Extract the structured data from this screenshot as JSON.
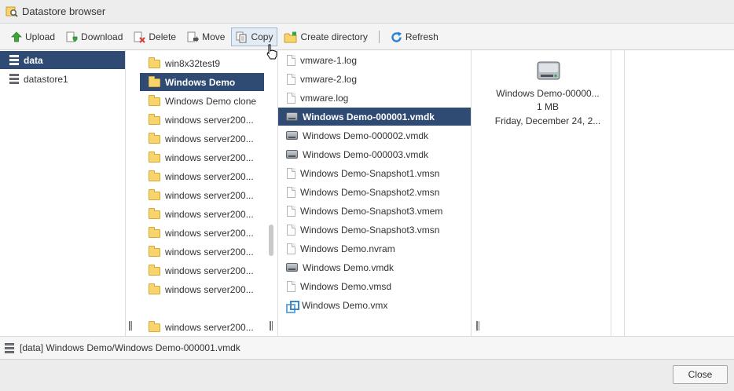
{
  "window": {
    "title": "Datastore browser"
  },
  "toolbar": {
    "upload": "Upload",
    "download": "Download",
    "delete": "Delete",
    "move": "Move",
    "copy": "Copy",
    "create_directory": "Create directory",
    "refresh": "Refresh"
  },
  "datastores": [
    {
      "label": "data",
      "selected": true
    },
    {
      "label": "datastore1",
      "selected": false
    }
  ],
  "folders": [
    {
      "label": "win8x32test9"
    },
    {
      "label": "Windows Demo",
      "selected": true
    },
    {
      "label": "Windows Demo clone"
    },
    {
      "label": "windows server200..."
    },
    {
      "label": "windows server200..."
    },
    {
      "label": "windows server200..."
    },
    {
      "label": "windows server200..."
    },
    {
      "label": "windows server200..."
    },
    {
      "label": "windows server200..."
    },
    {
      "label": "windows server200..."
    },
    {
      "label": "windows server200..."
    },
    {
      "label": "windows server200..."
    },
    {
      "label": "windows server200..."
    },
    {
      "label": "windows server200..."
    }
  ],
  "files": [
    {
      "label": "vmware-1.log",
      "icon": "doc"
    },
    {
      "label": "vmware-2.log",
      "icon": "doc"
    },
    {
      "label": "vmware.log",
      "icon": "doc"
    },
    {
      "label": "Windows Demo-000001.vmdk",
      "icon": "disk",
      "selected": true
    },
    {
      "label": "Windows Demo-000002.vmdk",
      "icon": "disk"
    },
    {
      "label": "Windows Demo-000003.vmdk",
      "icon": "disk"
    },
    {
      "label": "Windows Demo-Snapshot1.vmsn",
      "icon": "doc"
    },
    {
      "label": "Windows Demo-Snapshot2.vmsn",
      "icon": "doc"
    },
    {
      "label": "Windows Demo-Snapshot3.vmem",
      "icon": "doc"
    },
    {
      "label": "Windows Demo-Snapshot3.vmsn",
      "icon": "doc"
    },
    {
      "label": "Windows Demo.nvram",
      "icon": "doc"
    },
    {
      "label": "Windows Demo.vmdk",
      "icon": "disk"
    },
    {
      "label": "Windows Demo.vmsd",
      "icon": "doc"
    },
    {
      "label": "Windows Demo.vmx",
      "icon": "vmx"
    }
  ],
  "preview": {
    "name": "Windows Demo-00000...",
    "size": "1 MB",
    "date": "Friday, December 24, 2..."
  },
  "status": {
    "path": "[data] Windows Demo/Windows Demo-000001.vmdk"
  },
  "footer": {
    "close_label": "Close"
  },
  "colors": {
    "selection": "#2f4b73",
    "accent_green": "#3aa63a",
    "refresh_blue": "#2d7fd3"
  }
}
